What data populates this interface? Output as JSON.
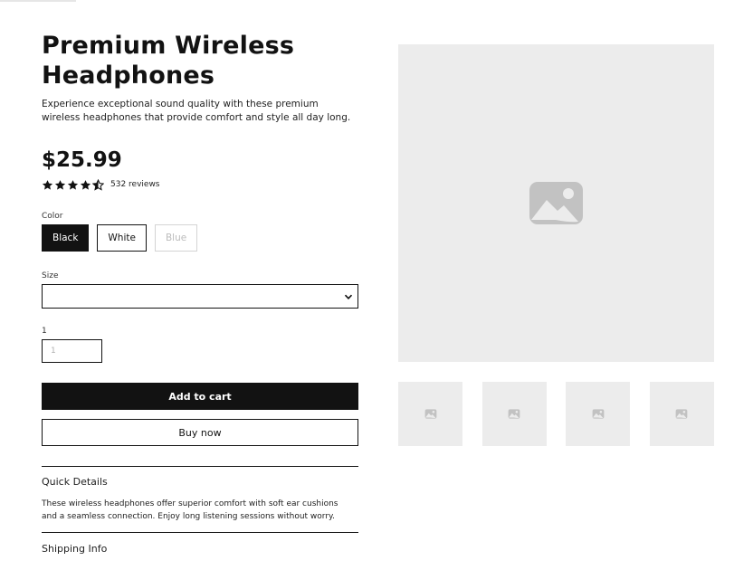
{
  "product": {
    "title": "Premium Wireless Headphones",
    "description": "Experience exceptional sound quality with these premium wireless headphones that provide comfort and style all day long.",
    "price": "$25.99",
    "rating": 4.5,
    "reviews_text": "532 reviews"
  },
  "options": {
    "color_label": "Color",
    "colors": [
      {
        "label": "Black",
        "state": "selected"
      },
      {
        "label": "White",
        "state": "available"
      },
      {
        "label": "Blue",
        "state": "disabled"
      }
    ],
    "size_label": "Size",
    "size_value": "",
    "quantity_label": "1",
    "quantity_placeholder": "1"
  },
  "actions": {
    "add_to_cart": "Add to cart",
    "buy_now": "Buy now"
  },
  "accordion": {
    "quick_details_title": "Quick Details",
    "quick_details_body": "These wireless headphones offer superior comfort with soft ear cushions and a seamless connection. Enjoy long listening sessions without worry.",
    "shipping_title": "Shipping Info"
  },
  "gallery": {
    "main_icon": "image-placeholder-icon",
    "thumb_count": 4
  },
  "colors": {
    "primary": "#121212",
    "placeholder_bg": "#ececec",
    "placeholder_icon": "#c2c2c2"
  }
}
